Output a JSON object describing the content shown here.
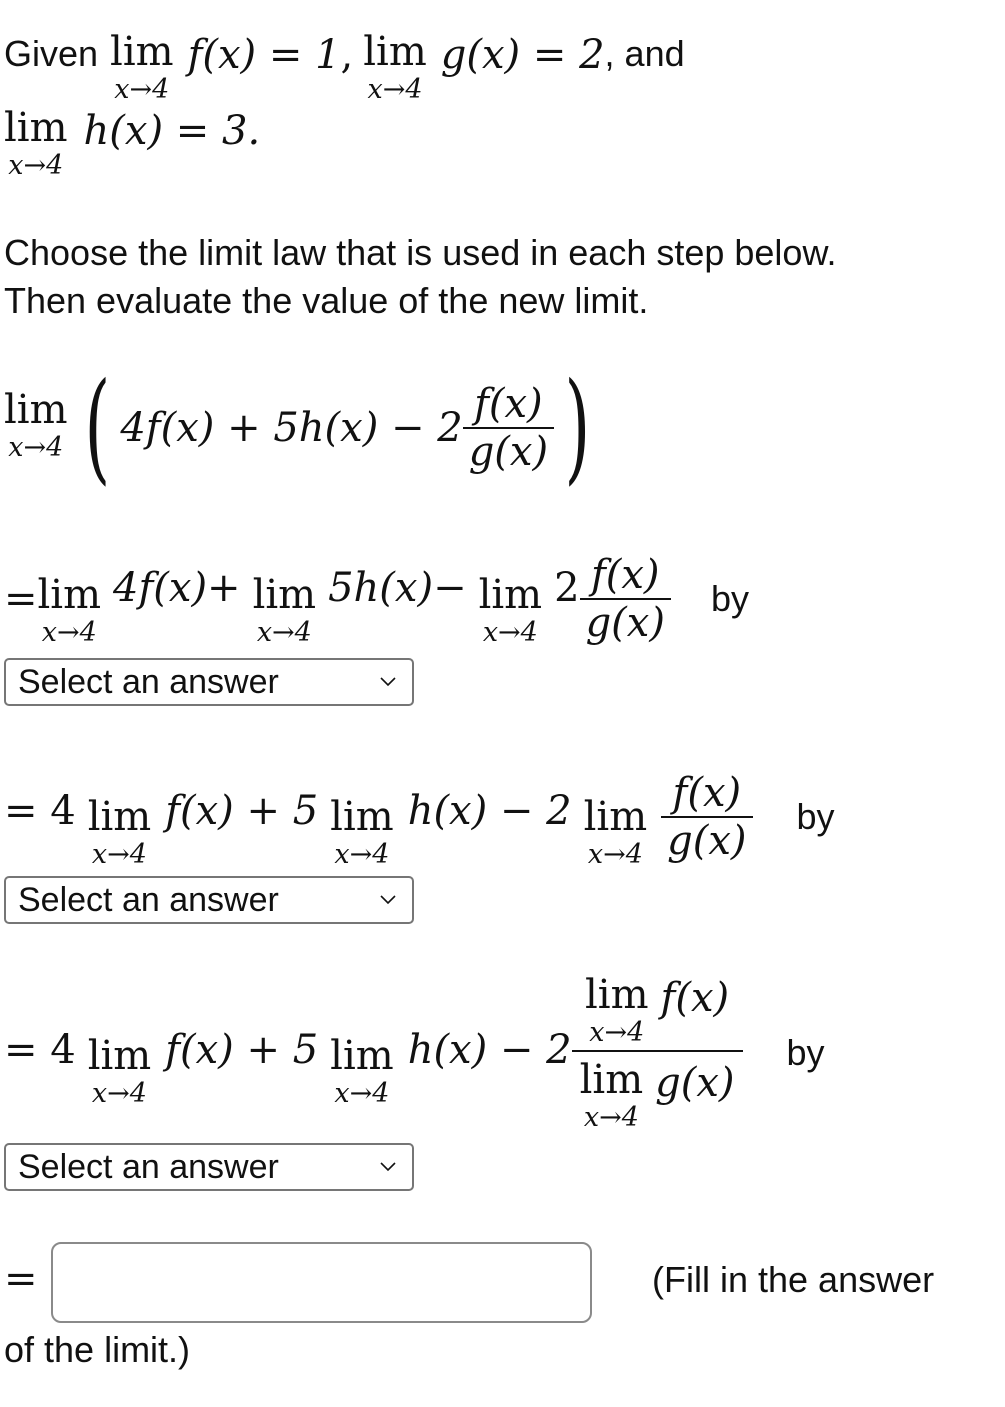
{
  "given": {
    "prefix": "Given",
    "and_word": ", and",
    "limits": [
      {
        "lim": "lim",
        "sub": "x→4",
        "expr": "f(x) = 1"
      },
      {
        "lim": "lim",
        "sub": "x→4",
        "expr": "g(x) = 2"
      },
      {
        "lim": "lim",
        "sub": "x→4",
        "expr": "h(x) = 3."
      }
    ],
    "comma": ","
  },
  "instructions": {
    "line1": "Choose the limit law that is used in each step below.",
    "line2": "Then evaluate the value of the new limit."
  },
  "problem": {
    "lim": "lim",
    "sub": "x→4",
    "open_paren": "(",
    "body": "4f(x) + 5h(x) − 2",
    "frac_num": "f(x)",
    "frac_den": "g(x)",
    "close_paren": ")"
  },
  "steps": [
    {
      "eq": "=",
      "terms": [
        {
          "lim": "lim",
          "sub": "x→4",
          "expr": "4f(x)+"
        },
        {
          "lim": "lim",
          "sub": "x→4",
          "expr": "5h(x)−"
        },
        {
          "lim": "lim",
          "sub": "x→4",
          "expr": "2"
        }
      ],
      "frac_num": "f(x)",
      "frac_den": "g(x)",
      "by": "by",
      "select": {
        "value": "Select an answer"
      }
    },
    {
      "eq": "= 4",
      "terms": [
        {
          "lim": "lim",
          "sub": "x→4",
          "expr": "f(x) + 5"
        },
        {
          "lim": "lim",
          "sub": "x→4",
          "expr": "h(x) − 2"
        },
        {
          "lim": "lim",
          "sub": "x→4",
          "expr": ""
        }
      ],
      "frac_num": "f(x)",
      "frac_den": "g(x)",
      "by": "by",
      "select": {
        "value": "Select an answer"
      }
    },
    {
      "eq": "= 4",
      "terms": [
        {
          "lim": "lim",
          "sub": "x→4",
          "expr": "f(x) + 5"
        },
        {
          "lim": "lim",
          "sub": "x→4",
          "expr": "h(x) − 2"
        }
      ],
      "frac_num": {
        "lim": "lim",
        "sub": "x→4",
        "expr": "f(x)"
      },
      "frac_den": {
        "lim": "lim",
        "sub": "x→4",
        "expr": "g(x)"
      },
      "by": "by",
      "select": {
        "value": "Select an answer"
      }
    }
  ],
  "final": {
    "eq": "=",
    "input_value": "",
    "note_line1": "(Fill in the answer",
    "note_line2": "of the limit.)"
  }
}
